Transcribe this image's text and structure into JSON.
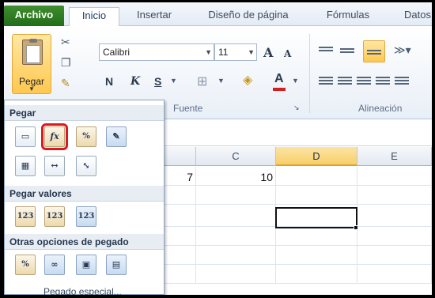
{
  "tabs": {
    "file": "Archivo",
    "home": "Inicio",
    "insert": "Insertar",
    "page_layout": "Diseño de página",
    "formulas": "Fórmulas",
    "data": "Datos"
  },
  "ribbon": {
    "paste_label": "Pegar",
    "font_name": "Calibri",
    "font_size": "11",
    "bold": "N",
    "italic": "K",
    "underline": "S",
    "grow_font": "A",
    "shrink_font": "A",
    "font_color": "A",
    "group_font": "Fuente",
    "group_alignment": "Alineación",
    "accent_color": "#ffc84f",
    "font_color_bar": "#d31f1f"
  },
  "sheet": {
    "columns": [
      "C",
      "D",
      "E"
    ],
    "selected_column": "D",
    "cells": {
      "b1": "7",
      "c1": "10"
    }
  },
  "paste_menu": {
    "section_paste": "Pegar",
    "section_values": "Pegar valores",
    "section_other": "Otras opciones de pegado",
    "paste_special": "Pegado especial...",
    "icons_paste": [
      "paste-icon",
      "paste-formulas-icon",
      "paste-formulas-number-format-icon",
      "paste-keep-source-format-icon",
      "paste-no-borders-icon",
      "paste-keep-column-widths-icon",
      "paste-transpose-icon"
    ],
    "icons_values": [
      "paste-values-icon",
      "paste-values-number-format-icon",
      "paste-values-source-format-icon"
    ],
    "icons_other": [
      "paste-formatting-icon",
      "paste-link-icon",
      "paste-picture-icon",
      "paste-linked-picture-icon"
    ],
    "formula_glyph": "fx",
    "percent_glyph": "%",
    "values_glyph": "123",
    "highlight_color": "#d9191f"
  }
}
